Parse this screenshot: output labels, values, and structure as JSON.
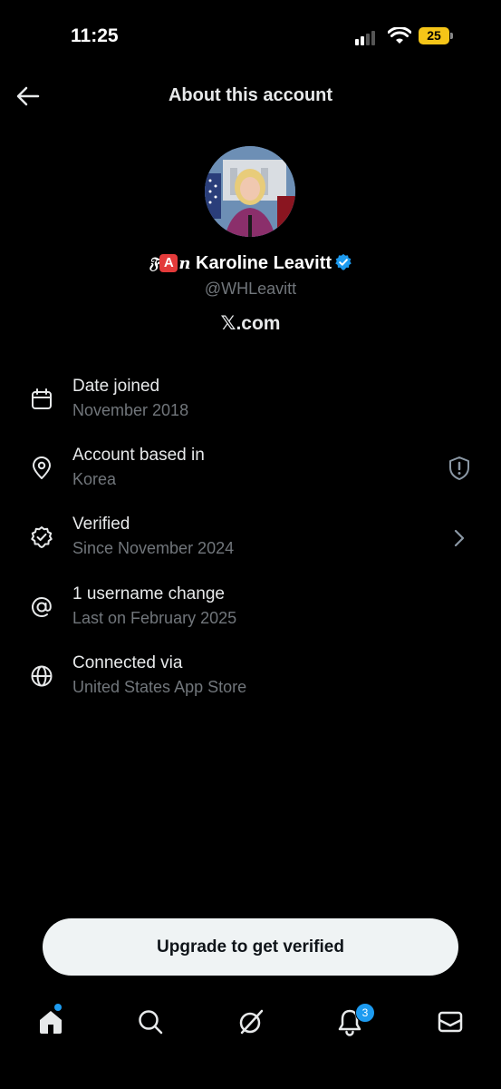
{
  "status_bar": {
    "time": "11:25",
    "battery": "25"
  },
  "header": {
    "title": "About this account"
  },
  "profile": {
    "name_prefix_1": "𝔉",
    "name_prefix_badge": "A",
    "name_prefix_2": "𝒏",
    "name": "Karoline Leavitt",
    "handle": "@WHLeavitt",
    "site": "𝕏.com"
  },
  "info_rows": [
    {
      "title": "Date joined",
      "subtitle": "November 2018",
      "icon": "calendar-icon"
    },
    {
      "title": "Account based in",
      "subtitle": "Korea",
      "icon": "location-pin-icon"
    },
    {
      "title": "Verified",
      "subtitle": "Since November 2024",
      "icon": "verified-seal-icon"
    },
    {
      "title": "1 username change",
      "subtitle": "Last on February 2025",
      "icon": "at-sign-icon"
    },
    {
      "title": "Connected via",
      "subtitle": "United States App Store",
      "icon": "globe-icon"
    }
  ],
  "upgrade_button": {
    "label": "Upgrade to get verified"
  },
  "bottom_nav": {
    "notifications_count": "3"
  },
  "colors": {
    "accent": "#1d9bf0",
    "muted": "#71767b",
    "background": "#000000"
  }
}
